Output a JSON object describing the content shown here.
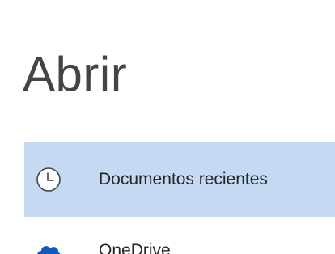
{
  "page": {
    "title": "Abrir"
  },
  "nav": {
    "items": [
      {
        "label": "Documentos recientes",
        "icon": "clock-icon",
        "selected": true
      },
      {
        "label": "OneDrive",
        "icon": "onedrive-cloud-icon",
        "selected": false
      }
    ]
  },
  "colors": {
    "selected_background": "#c5d9f2",
    "title_text": "#444444",
    "item_text": "#262626",
    "onedrive_blue": "#0f5bb7"
  }
}
